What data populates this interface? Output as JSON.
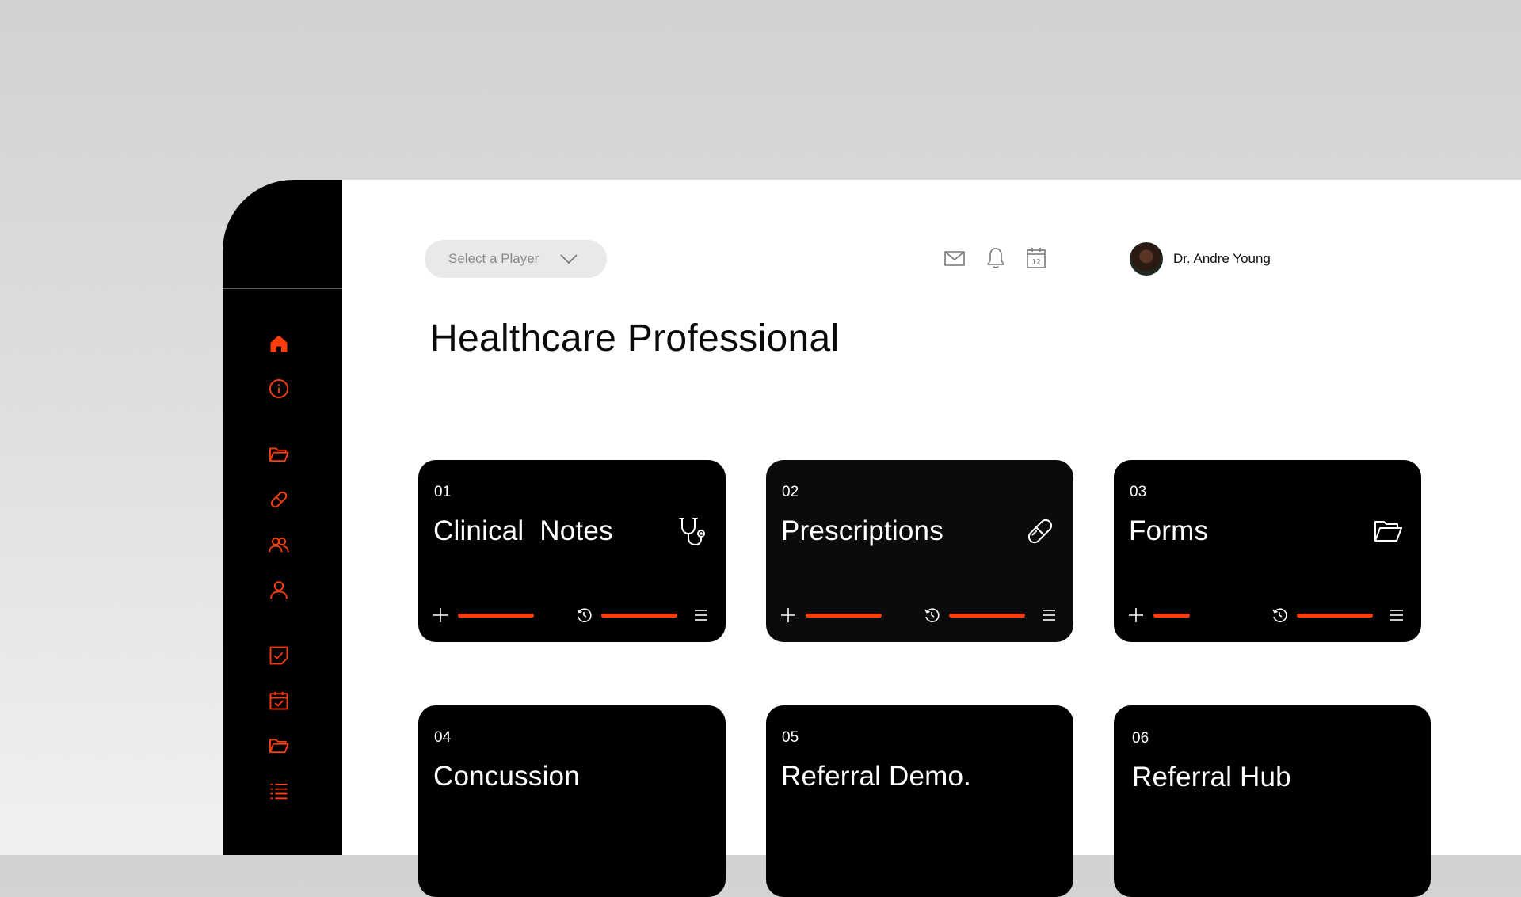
{
  "colors": {
    "accent": "#fe3d0a",
    "sidebar": "#000000",
    "card": "#000000",
    "background": "#d3d3d3"
  },
  "sidebar": {
    "items": [
      {
        "icon": "home-icon",
        "active": true
      },
      {
        "icon": "info-icon"
      },
      {
        "icon": "folder-open-icon"
      },
      {
        "icon": "pill-icon"
      },
      {
        "icon": "users-icon"
      },
      {
        "icon": "user-icon"
      },
      {
        "icon": "task-check-icon"
      },
      {
        "icon": "calendar-check-icon"
      },
      {
        "icon": "folder-open-icon"
      },
      {
        "icon": "list-icon"
      }
    ]
  },
  "header": {
    "player_select": {
      "placeholder": "Select a Player"
    },
    "icons": [
      "mail-icon",
      "bell-icon",
      "calendar-icon"
    ],
    "calendar_day": "12",
    "user": {
      "name": "Dr. Andre Young"
    }
  },
  "page": {
    "title": "Healthcare Professional"
  },
  "cards": [
    {
      "number": "01",
      "title": "Clinical  Notes",
      "icon": "stethoscope-icon",
      "progress_add": 1.0,
      "progress_history": 1.0
    },
    {
      "number": "02",
      "title": "Prescriptions",
      "icon": "pill-icon",
      "progress_add": 1.0,
      "progress_history": 1.0
    },
    {
      "number": "03",
      "title": "Forms",
      "icon": "folder-open-icon",
      "progress_add": 0.48,
      "progress_history": 1.0
    },
    {
      "number": "04",
      "title": "Concussion"
    },
    {
      "number": "05",
      "title": "Referral Demo."
    },
    {
      "number": "06",
      "title": "Referral Hub"
    }
  ]
}
